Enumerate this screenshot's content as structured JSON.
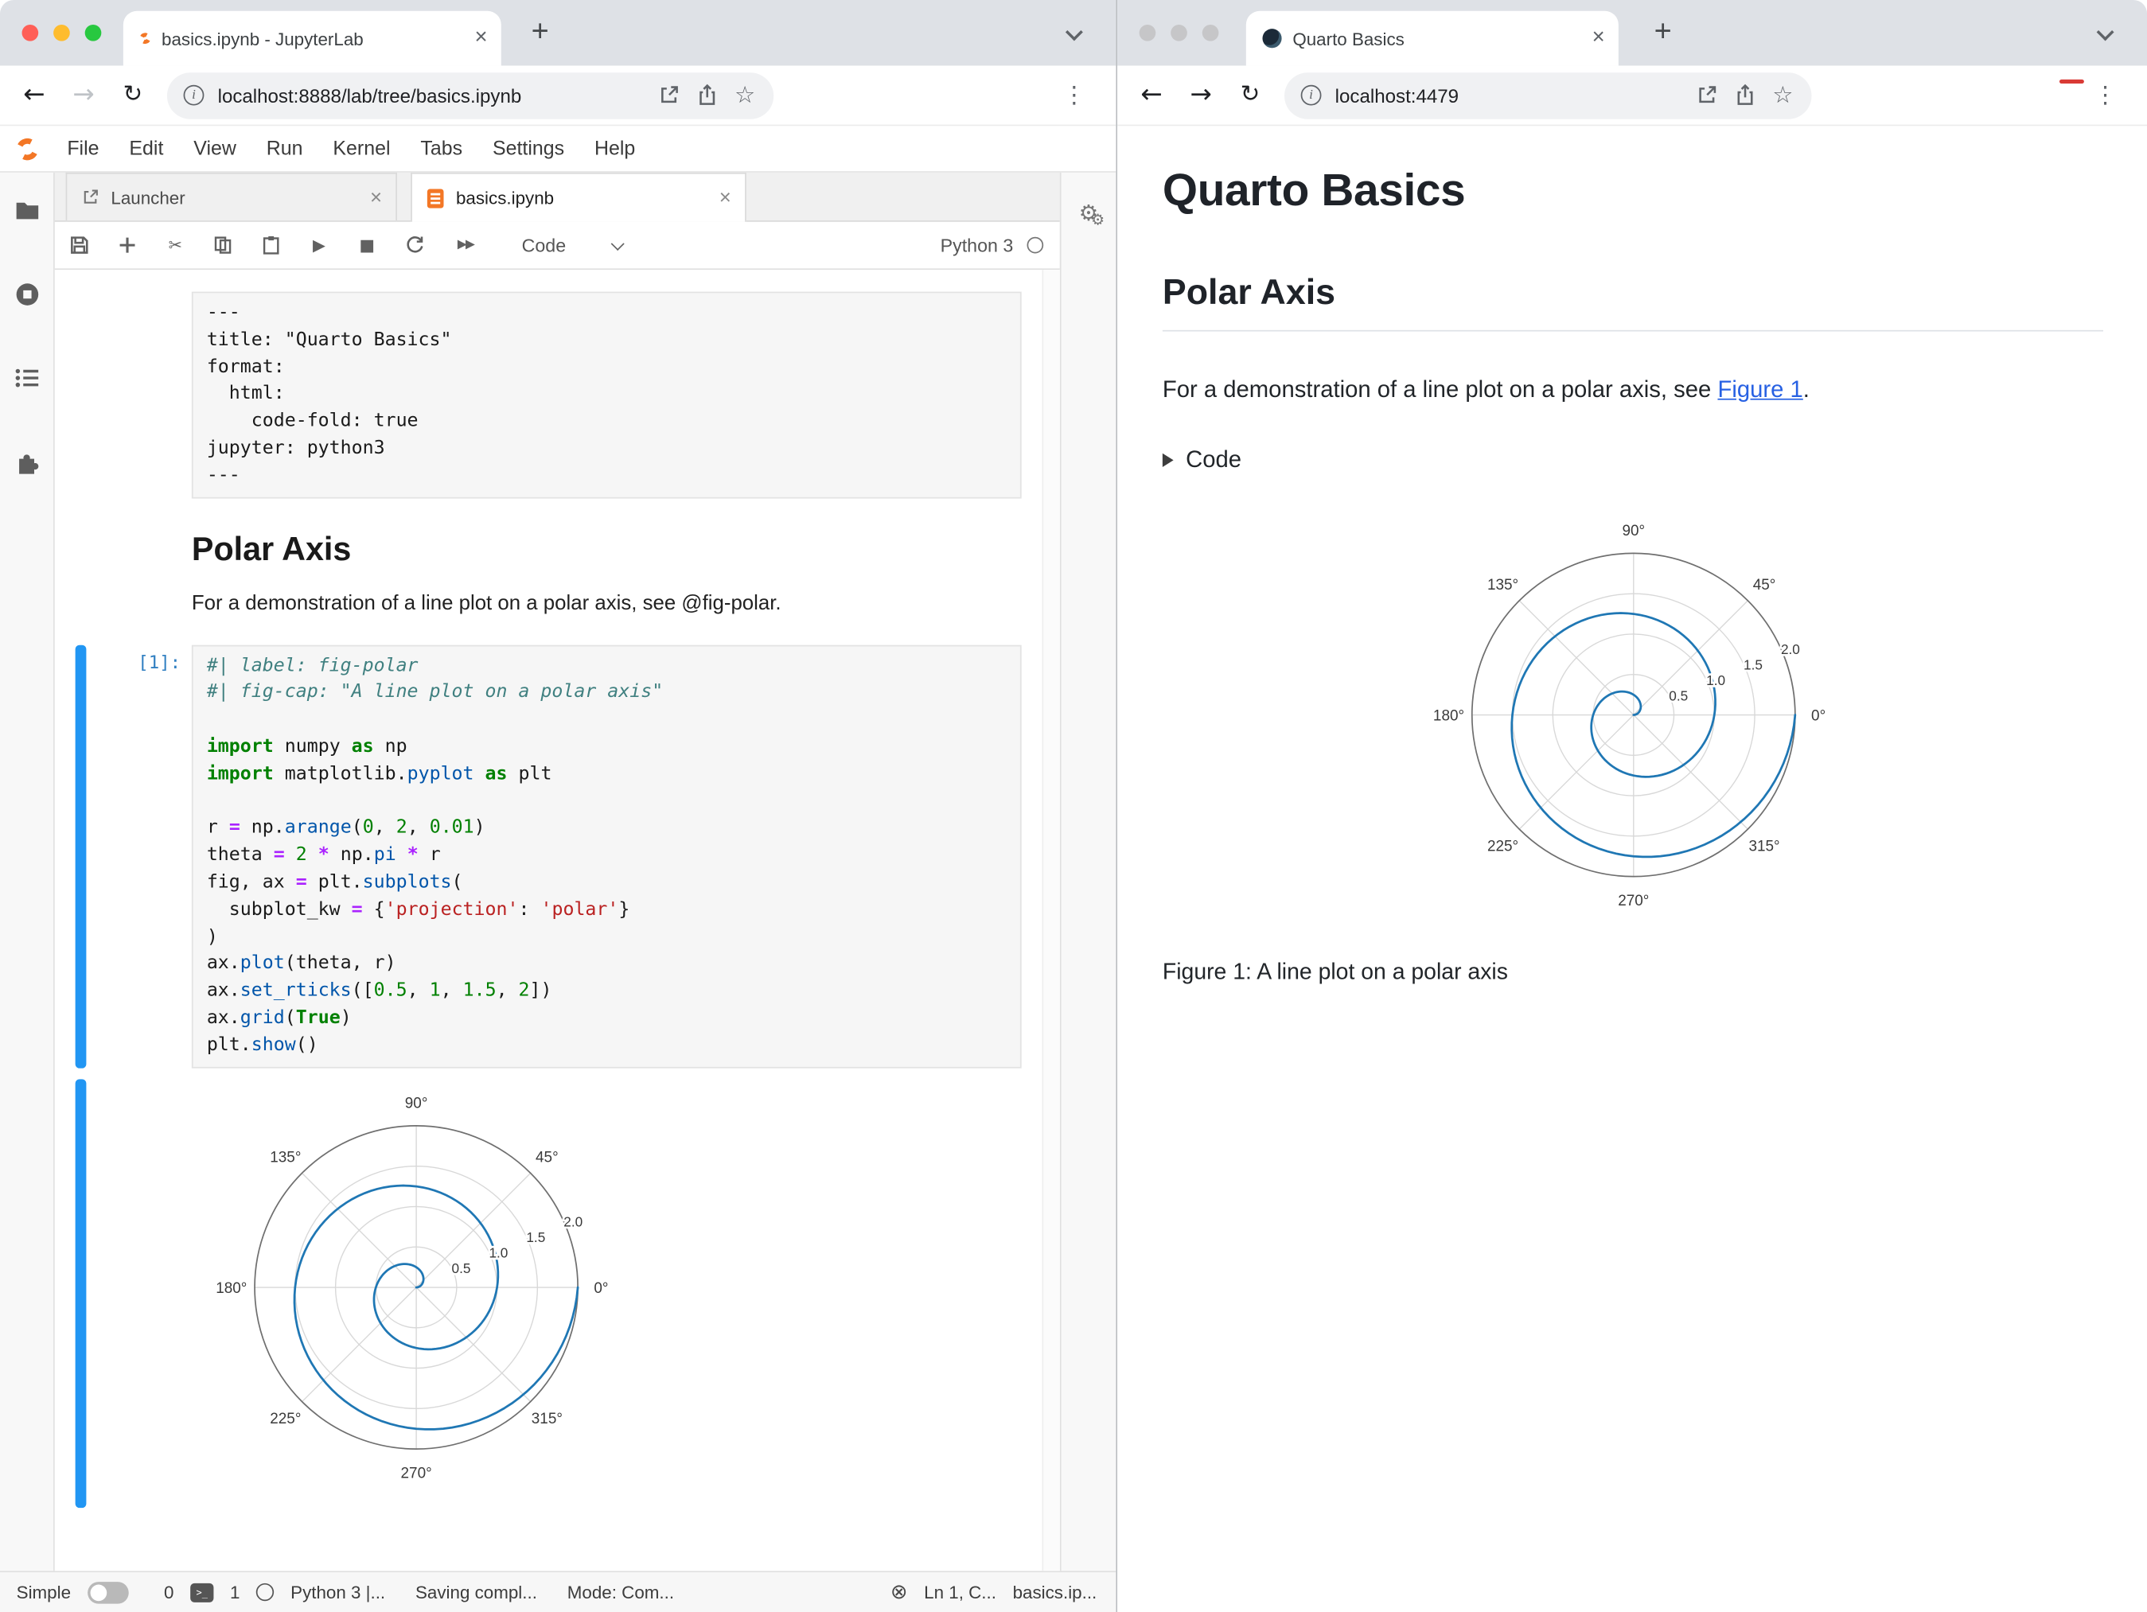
{
  "icons": {
    "close": "×",
    "new_tab": "+",
    "back": "←",
    "forward": "→",
    "reload": "↻",
    "star": "☆",
    "menu_dots": "⋮",
    "info": "i",
    "cut": "✂",
    "run": "▶",
    "stop": "■",
    "fast_forward": "▶▶",
    "gear": "⚙",
    "trust": "⊗",
    "terminal_prompt": ">_"
  },
  "left_window": {
    "browser": {
      "tab_title": "basics.ipynb - JupyterLab",
      "url": "localhost:8888/lab/tree/basics.ipynb"
    },
    "menubar": {
      "items": [
        "File",
        "Edit",
        "View",
        "Run",
        "Kernel",
        "Tabs",
        "Settings",
        "Help"
      ]
    },
    "doc_tabs": {
      "launcher": "Launcher",
      "notebook": "basics.ipynb"
    },
    "toolbar": {
      "cell_type": "Code",
      "kernel": "Python 3"
    },
    "notebook": {
      "raw_cell_lines": [
        "---",
        "title: \"Quarto Basics\"",
        "format:",
        "  html:",
        "    code-fold: true",
        "jupyter: python3",
        "---"
      ],
      "markdown": {
        "heading": "Polar Axis",
        "paragraph": "For a demonstration of a line plot on a polar axis, see @fig-polar."
      },
      "code_cell": {
        "prompt": "[1]:",
        "lines": [
          [
            [
              "com",
              "#| label: fig-polar"
            ]
          ],
          [
            [
              "com",
              "#| fig-cap: \"A line plot on a polar axis\""
            ]
          ],
          [],
          [
            [
              "kw",
              "import"
            ],
            [
              "",
              " numpy "
            ],
            [
              "kw",
              "as"
            ],
            [
              "",
              " np"
            ]
          ],
          [
            [
              "kw",
              "import"
            ],
            [
              "",
              " matplotlib."
            ],
            [
              "prop",
              "pyplot"
            ],
            [
              "",
              " "
            ],
            [
              "kw",
              "as"
            ],
            [
              "",
              " plt"
            ]
          ],
          [],
          [
            [
              "",
              "r "
            ],
            [
              "op",
              "="
            ],
            [
              "",
              " np."
            ],
            [
              "prop",
              "arange"
            ],
            [
              "",
              "("
            ],
            [
              "num",
              "0"
            ],
            [
              "",
              ", "
            ],
            [
              "num",
              "2"
            ],
            [
              "",
              ", "
            ],
            [
              "num",
              "0.01"
            ],
            [
              "",
              ")"
            ]
          ],
          [
            [
              "",
              "theta "
            ],
            [
              "op",
              "="
            ],
            [
              "",
              " "
            ],
            [
              "num",
              "2"
            ],
            [
              "",
              " "
            ],
            [
              "op",
              "*"
            ],
            [
              "",
              " np."
            ],
            [
              "prop",
              "pi"
            ],
            [
              "",
              " "
            ],
            [
              "op",
              "*"
            ],
            [
              "",
              " r"
            ]
          ],
          [
            [
              "",
              "fig, ax "
            ],
            [
              "op",
              "="
            ],
            [
              "",
              " plt."
            ],
            [
              "prop",
              "subplots"
            ],
            [
              "",
              "("
            ]
          ],
          [
            [
              "",
              "  subplot_kw "
            ],
            [
              "op",
              "="
            ],
            [
              "",
              " {"
            ],
            [
              "str",
              "'projection'"
            ],
            [
              "",
              ": "
            ],
            [
              "str",
              "'polar'"
            ],
            [
              "",
              "}"
            ]
          ],
          [
            [
              "",
              ")"
            ]
          ],
          [
            [
              "",
              "ax."
            ],
            [
              "prop",
              "plot"
            ],
            [
              "",
              "(theta, r)"
            ]
          ],
          [
            [
              "",
              "ax."
            ],
            [
              "prop",
              "set_rticks"
            ],
            [
              "",
              "(["
            ],
            [
              "num",
              "0.5"
            ],
            [
              "",
              ", "
            ],
            [
              "num",
              "1"
            ],
            [
              "",
              ", "
            ],
            [
              "num",
              "1.5"
            ],
            [
              "",
              ", "
            ],
            [
              "num",
              "2"
            ],
            [
              "",
              "])"
            ]
          ],
          [
            [
              "",
              "ax."
            ],
            [
              "prop",
              "grid"
            ],
            [
              "",
              "("
            ],
            [
              "kw",
              "True"
            ],
            [
              "",
              ")"
            ]
          ],
          [
            [
              "",
              "plt."
            ],
            [
              "prop",
              "show"
            ],
            [
              "",
              "()"
            ]
          ]
        ]
      }
    },
    "statusbar": {
      "simple_label": "Simple",
      "terminals_count": "0",
      "kernels_count": "1",
      "kernel_status": "Python 3 |...",
      "saving_status": "Saving compl...",
      "mode": "Mode: Com...",
      "cursor_position": "Ln 1, C...",
      "filename": "basics.ip..."
    }
  },
  "right_window": {
    "browser": {
      "tab_title": "Quarto Basics",
      "url": "localhost:4479"
    },
    "page": {
      "title": "Quarto Basics",
      "section_heading": "Polar Axis",
      "para_before_link": "For a demonstration of a line plot on a polar axis, see ",
      "link_text": "Figure 1",
      "para_after_link": ".",
      "code_fold_label": "Code",
      "figure_caption": "Figure 1: A line plot on a polar axis"
    }
  },
  "chart_data": {
    "type": "line",
    "projection": "polar",
    "title": "",
    "series": [
      {
        "name": "theta = 2 * pi * r",
        "r_start": 0,
        "r_end": 2,
        "r_step": 0.01,
        "turns": 2,
        "color": "#1f77b4"
      }
    ],
    "rmax": 2.0,
    "rticks": [
      0.5,
      1.0,
      1.5,
      2.0
    ],
    "rtick_labels": [
      "0.5",
      "1.0",
      "1.5",
      "2.0"
    ],
    "rlabel_angle_deg": 22.5,
    "theta_tick_degrees": [
      0,
      45,
      90,
      135,
      180,
      225,
      270,
      315
    ],
    "theta_tick_labels": [
      "0°",
      "45°",
      "90°",
      "135°",
      "180°",
      "225°",
      "270°",
      "315°"
    ],
    "grid": true,
    "caption": "Figure 1: A line plot on a polar axis"
  }
}
